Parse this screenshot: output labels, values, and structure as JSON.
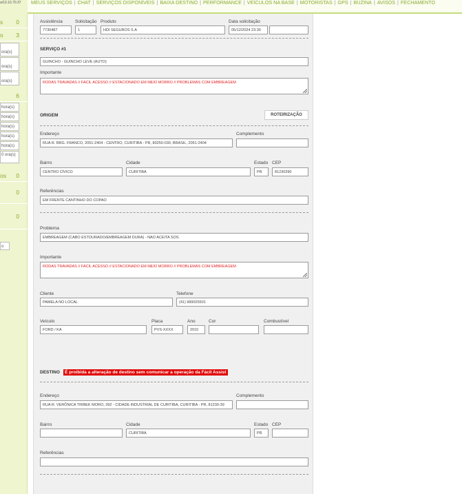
{
  "topbar": {
    "ip": "a/10.10.70.37",
    "nav": [
      "MEUS SERVIÇOS",
      "CHAT",
      "SERVIÇOS DISPONÍVEIS",
      "BAIXA DESTINO",
      "PERFORMANCE",
      "VEÍCULOS NA BASE",
      "MOTORISTAS",
      "GPS",
      "BUZINA",
      "AVISOS",
      "FECHAMENTO"
    ],
    "separator": "|"
  },
  "sidebar": {
    "rows": [
      {
        "label": "s",
        "count": "0"
      },
      {
        "label": "o",
        "count": "3"
      },
      {
        "label": "",
        "count": "6"
      },
      {
        "label": "os",
        "count": "0"
      },
      {
        "label": "",
        "count": "0"
      },
      {
        "label": "",
        "count": "0"
      }
    ],
    "boxes_a": [
      "ora(s)",
      "ora(s)",
      "ora(s)"
    ],
    "boxes_b": [
      "hora(s)",
      "hora(s)",
      "hora(s)",
      "hora(s)",
      "hora(s)",
      "0 ora(s)"
    ],
    "bottom_box": "o"
  },
  "header": {
    "assistencia": {
      "label": "Assistência",
      "value": "7730487"
    },
    "solicitacao": {
      "label": "Solicitação",
      "value": "1"
    },
    "produto": {
      "label": "Produto",
      "value": "HDI SEGUROS S.A"
    },
    "data": {
      "label": "Data solicitação",
      "value": "05/12/2024 23:30",
      "extra": ""
    }
  },
  "servico": {
    "title": "SERVIÇO #1",
    "value": "GUINCHO - GUINCHO LEVE (AUTO)",
    "importante_label": "Importante",
    "importante": "RODAS TRAVADAS // FACIL ACESSO // ESTACIONADO EM MEIO MORRO // PROBLEMAS COM EMBREAGEM"
  },
  "origem": {
    "title": "ORIGEM",
    "button": "ROTEIRIZAÇÃO",
    "endereco": {
      "label": "Endereço",
      "value": "RUA R. BRG. FRANCO, 2051-2404 - CENTRO, CURITIBA - PR, 80250-030, BRASIL, 2051-2404"
    },
    "complemento": {
      "label": "Complemento",
      "value": ""
    },
    "bairro": {
      "label": "Bairro",
      "value": "CENTRO CÍVICO"
    },
    "cidade": {
      "label": "Cidade",
      "value": "CURITIBA"
    },
    "estado": {
      "label": "Estado",
      "value": "PR"
    },
    "cep": {
      "label": "CEP",
      "value": "81230390"
    },
    "referencias": {
      "label": "Referências",
      "value": "EM FRENTE CANTINHO DO COPAO"
    }
  },
  "problema": {
    "label": "Problema",
    "value": "EMBREAGEM (CABO ESTOURADO/EMBREAGEM DURA) - NAO ACEITA SOS",
    "importante_label": "Importante",
    "importante": "RODAS TRAVADAS // FACIL ACESSO // ESTACIONADO EM MEIO MORRO // PROBLEMAS COM EMBREAGEM"
  },
  "cliente": {
    "label": "Cliente",
    "value": "PAMELA NO LOCAL"
  },
  "telefone": {
    "label": "Telefone",
    "value": "(41) 989025501"
  },
  "veiculo": {
    "label": "Veículo",
    "value": "FORD / KA"
  },
  "placa": {
    "label": "Placa",
    "value": "PVS-XXXX"
  },
  "ano": {
    "label": "Ano",
    "value": "2015"
  },
  "cor": {
    "label": "Cor",
    "value": ""
  },
  "combustivel": {
    "label": "Combustível",
    "value": ""
  },
  "destino": {
    "title": "DESTINO",
    "warning": "É proibida a alteração de destino sem comunicar a operação da Fácil Assist",
    "endereco": {
      "label": "Endereço",
      "value": "RUA R. VERÔNICA TRIBEK MORO, 392 - CIDADE INDUSTRIAL DE CURITIBA, CURITIBA - PR, 81230-39"
    },
    "complemento": {
      "label": "Complemento",
      "value": ""
    },
    "bairro": {
      "label": "Bairro",
      "value": ""
    },
    "cidade": {
      "label": "Cidade",
      "value": "CURITIBA"
    },
    "estado": {
      "label": "Estado",
      "value": "PR"
    },
    "cep": {
      "label": "CEP",
      "value": ""
    },
    "referencias": {
      "label": "Referências",
      "value": ""
    }
  }
}
